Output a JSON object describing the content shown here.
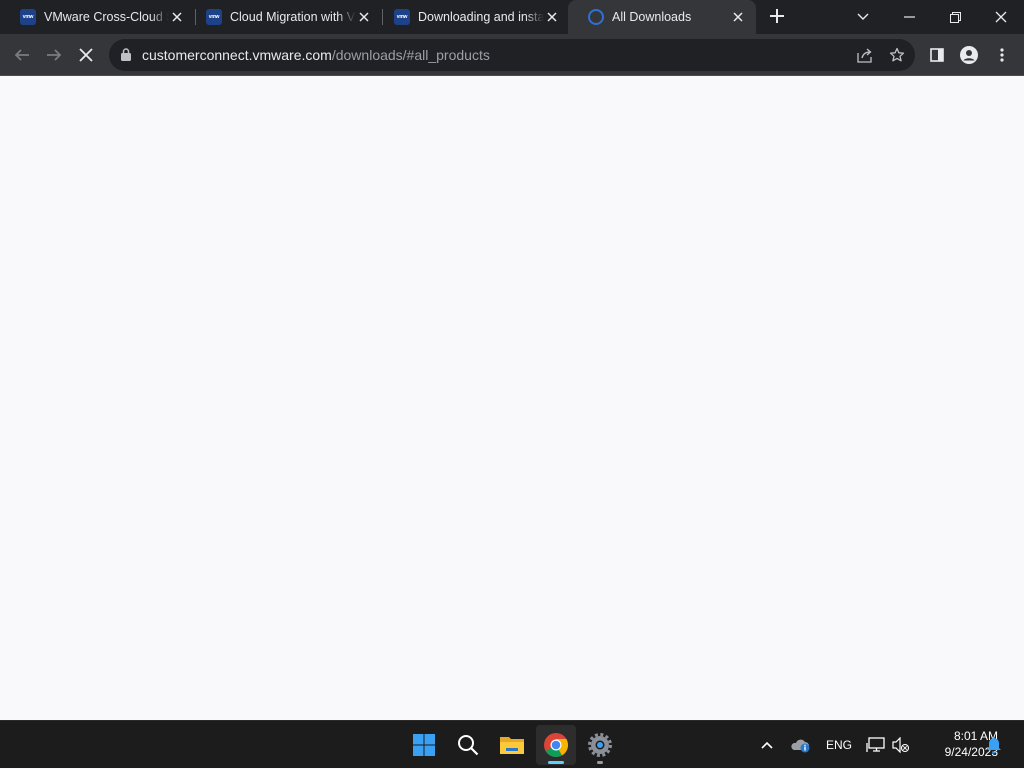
{
  "tabs": [
    {
      "title": "VMware Cross-Cloud Services",
      "favicon": "vmware-favicon",
      "active": false
    },
    {
      "title": "Cloud Migration with VMware",
      "favicon": "vmware-favicon",
      "active": false
    },
    {
      "title": "Downloading and installing",
      "favicon": "vmware-favicon",
      "active": false
    },
    {
      "title": "All Downloads",
      "favicon": "loading-spinner-icon",
      "active": true
    }
  ],
  "favicon_text": "vmw",
  "address_bar": {
    "host": "customerconnect.vmware.com",
    "path": "/downloads/#all_products"
  },
  "page": {
    "state": "loading",
    "background": "#f9f9fb"
  },
  "taskbar": {
    "apps": [
      "start-icon",
      "search-icon",
      "file-explorer-icon",
      "chrome-icon",
      "settings-icon"
    ],
    "active_app": "chrome-icon"
  },
  "tray": {
    "language": "ENG",
    "time": "8:01 AM",
    "date": "9/24/2023"
  },
  "colors": {
    "tabstrip": "#202124",
    "active_tab": "#35363a",
    "omnibox": "#202124",
    "taskbar": "#1c1c1c",
    "accent": "#1d428a"
  }
}
